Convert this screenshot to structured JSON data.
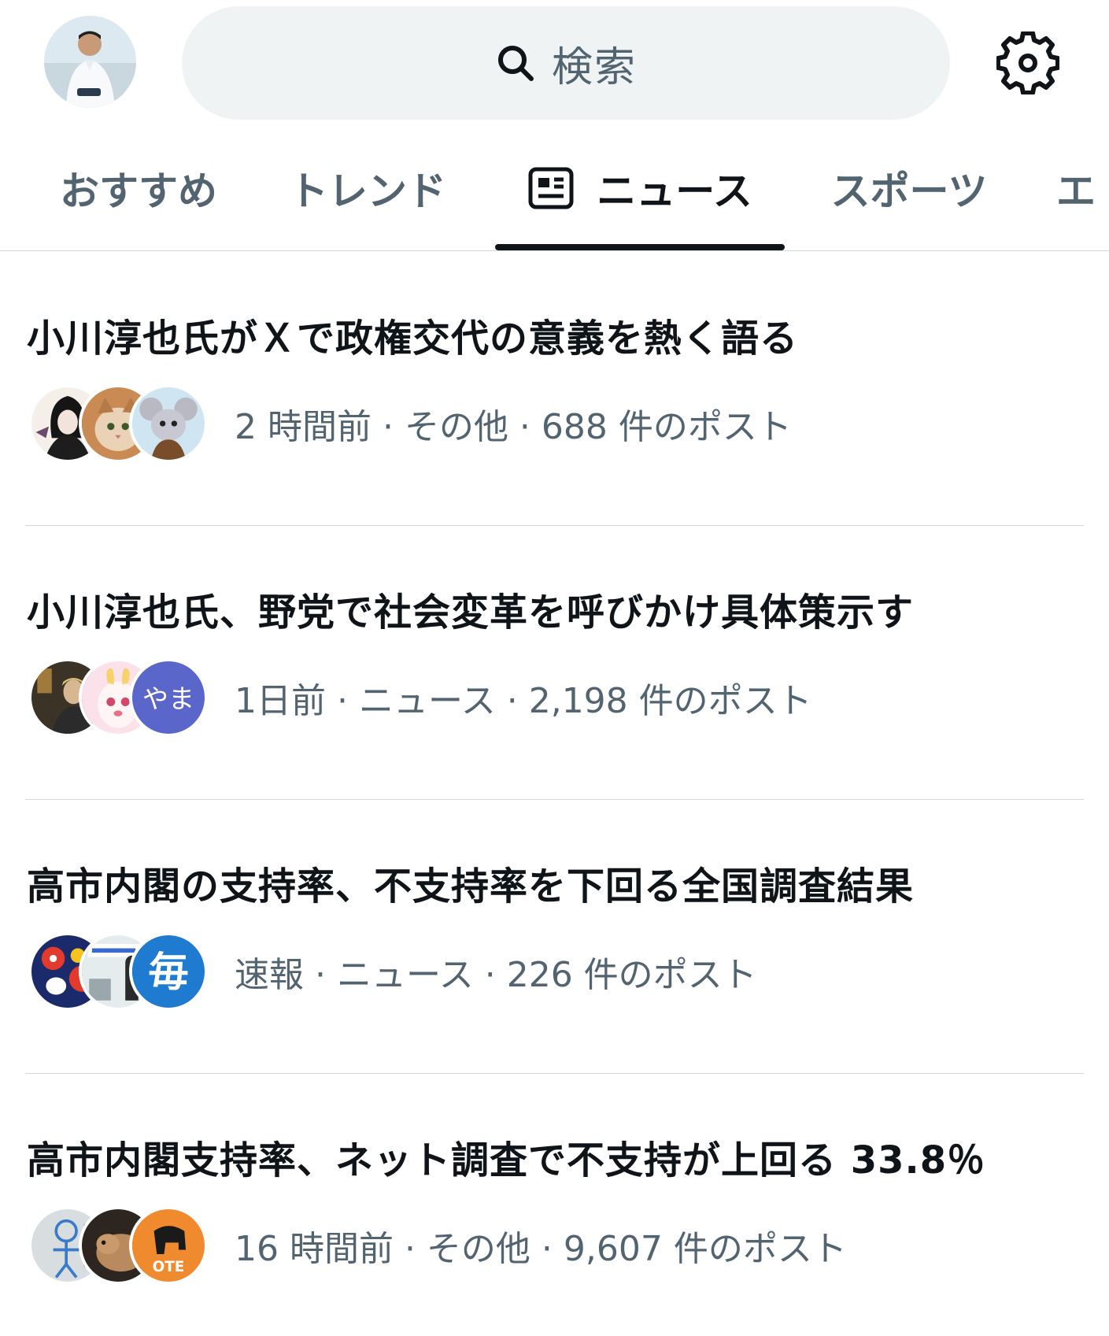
{
  "header": {
    "search_label": "検索"
  },
  "tabs": [
    {
      "label": "おすすめ",
      "active": false
    },
    {
      "label": "トレンド",
      "active": false
    },
    {
      "label": "ニュース",
      "active": true,
      "icon": "newspaper-icon"
    },
    {
      "label": "スポーツ",
      "active": false
    },
    {
      "label": "エ",
      "active": false
    }
  ],
  "news": [
    {
      "title": "小川淳也氏がＸで政権交代の意義を熱く語る",
      "meta": "2 時間前 · その他 · 688 件のポスト",
      "avatars": [
        "gothic-woman-avatar",
        "cat-avatar",
        "mouse-avatar"
      ]
    },
    {
      "title": "小川淳也氏、野党で社会変革を呼びかけ具体策示す",
      "meta": "1日前 · ニュース · 2,198 件のポスト",
      "avatars": [
        "dark-portrait-avatar",
        "bunny-egg-avatar",
        "yama-text-avatar"
      ],
      "avatar_text": "やま"
    },
    {
      "title": "高市内閣の支持率、不支持率を下回る全国調査結果",
      "meta": "速報 · ニュース · 226 件のポスト",
      "avatars": [
        "penguin-avatar",
        "video-thumb-avatar",
        "mainichi-avatar"
      ],
      "avatar_text": "毎"
    },
    {
      "title": "高市内閣支持率、ネット調査で不支持が上回る 33.8％",
      "meta": "16 時間前 · その他 · 9,607 件のポスト",
      "avatars": [
        "sketch-avatar",
        "dog-avatar",
        "elephant-avatar"
      ],
      "avatar_text": "OTE"
    }
  ],
  "colors": {
    "text_primary": "#0f1419",
    "text_secondary": "#536471",
    "search_bg": "#eff3f4",
    "divider": "#cfd9de"
  }
}
